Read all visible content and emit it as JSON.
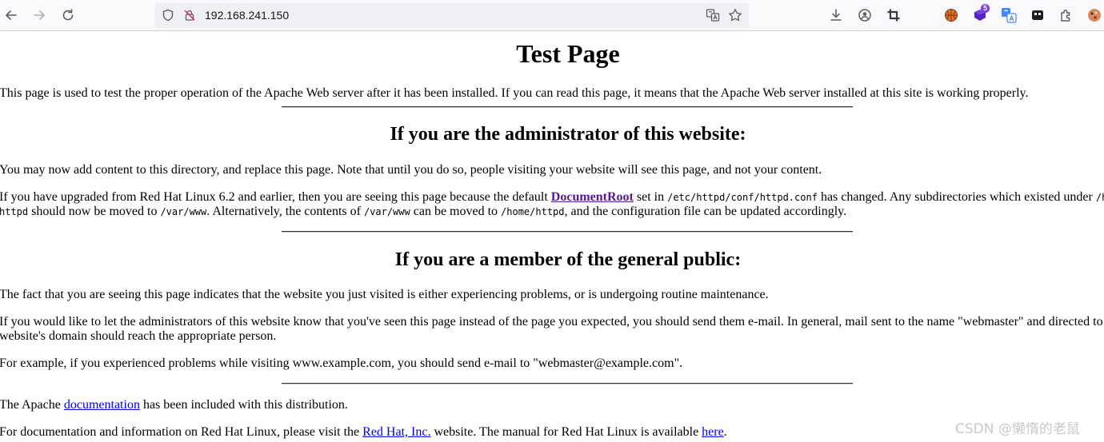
{
  "browser": {
    "url": "192.168.241.150",
    "extension_badge": "5"
  },
  "page": {
    "title": "Test Page",
    "intro": "This page is used to test the proper operation of the Apache Web server after it has been installed. If you can read this page, it means that the Apache Web server installed at this site is working properly.",
    "admin_heading": "If you are the administrator of this website:",
    "admin_p1": "You may now add content to this directory, and replace this page. Note that until you do so, people visiting your website will see this page, and not your content.",
    "admin_p2": {
      "t1": "If you have upgraded from Red Hat Linux 6.2 and earlier, then you are seeing this page because the default ",
      "link": "DocumentRoot",
      "t2": " set in ",
      "code1": "/etc/httpd/conf/httpd.conf",
      "t3": " has changed. Any subdirectories which existed under ",
      "code2": "/ho",
      "code3": "httpd",
      "t4": " should now be moved to ",
      "code4": "/var/www",
      "t5": ". Alternatively, the contents of ",
      "code5": "/var/www",
      "t6": " can be moved to ",
      "code6": "/home/httpd",
      "t7": ", and the configuration file can be updated accordingly."
    },
    "public_heading": "If you are a member of the general public:",
    "public_p1": "The fact that you are seeing this page indicates that the website you just visited is either experiencing problems, or is undergoing routine maintenance.",
    "public_p2_line1": "If you would like to let the administrators of this website know that you've seen this page instead of the page you expected, you should send them e-mail. In general, mail sent to the name \"webmaster\" and directed to",
    "public_p2_line2": "website's domain should reach the appropriate person.",
    "public_p3": "For example, if you experienced problems while visiting www.example.com, you should send e-mail to \"webmaster@example.com\".",
    "footer_p1": {
      "t1": "The Apache ",
      "link": "documentation",
      "t2": " has been included with this distribution."
    },
    "footer_p2": {
      "t1": "For documentation and information on Red Hat Linux, please visit the ",
      "link1": "Red Hat, Inc.",
      "t2": " website. The manual for Red Hat Linux is available ",
      "link2": "here",
      "t3": "."
    }
  },
  "watermark": "CSDN @懒惰的老鼠",
  "icons": [
    "back-icon",
    "forward-icon",
    "reload-icon",
    "shield-icon",
    "insecure-lock-icon",
    "translate-icon",
    "bookmark-star-icon",
    "download-icon",
    "account-icon",
    "crop-icon",
    "extension-basketball-icon",
    "extension-purple-icon",
    "extension-translate-icon",
    "extension-tab-icon",
    "extensions-puzzle-icon",
    "profile-avatar-icon"
  ]
}
